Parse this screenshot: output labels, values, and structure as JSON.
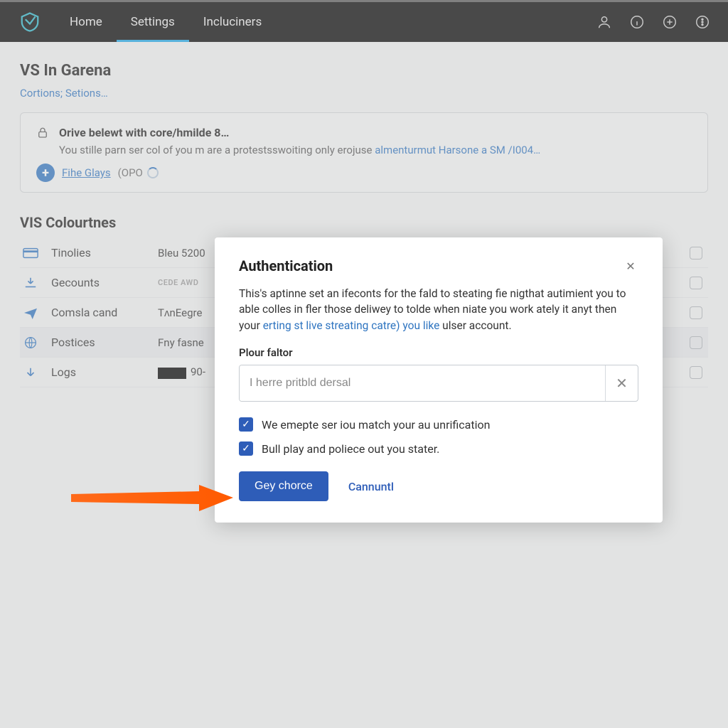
{
  "nav": {
    "tabs": [
      "Home",
      "Settings",
      "Incluciners"
    ],
    "active_index": 1
  },
  "page": {
    "title": "VS In Garena",
    "breadcrumb": [
      "Cortions;",
      "Setions…"
    ]
  },
  "info_card": {
    "title": "Orive belewt with core/hmilde 8…",
    "desc_pre": "You stille parn ser col of you m are a protestsswoiting only erojuse ",
    "desc_link": "almenturmut Harsone a SM /I004…",
    "action_link": "Fihe Glays",
    "action_extra": "(OPO"
  },
  "section_title": "VIS Colourtnes",
  "table": [
    {
      "icon": "card",
      "label": "Tinolies",
      "value": "Bleu 5200",
      "muted": false
    },
    {
      "icon": "download",
      "label": "Gecounts",
      "value": "CEDE AWD",
      "muted": true
    },
    {
      "icon": "plane",
      "label": "Comsla cand",
      "value": "TʌnEegre",
      "muted": false
    },
    {
      "icon": "globe",
      "label": "Postices",
      "value": "Fny fasne",
      "muted": false
    },
    {
      "icon": "arrowdown",
      "label": "Logs",
      "value": "90-",
      "muted": false,
      "blackbox": true
    }
  ],
  "modal": {
    "title": "Authentication",
    "body_pre": "This's aptinne set an ifeconts for the fald to steating fie nigthat autimient you to able colles in fler those deliwey to tolde when niate you work ately it anyt then your ",
    "body_link": "erting st live streating catre) you like",
    "body_post": " ulser account.",
    "field_label": "Plour faltor",
    "input_placeholder": "I herre pritbld dersal",
    "check1": "We emepte ser iou match your au unrification",
    "check2": "Bull play and poliece out you stater.",
    "btn_primary": "Gey chorce",
    "btn_cancel": "Cannuntl"
  }
}
